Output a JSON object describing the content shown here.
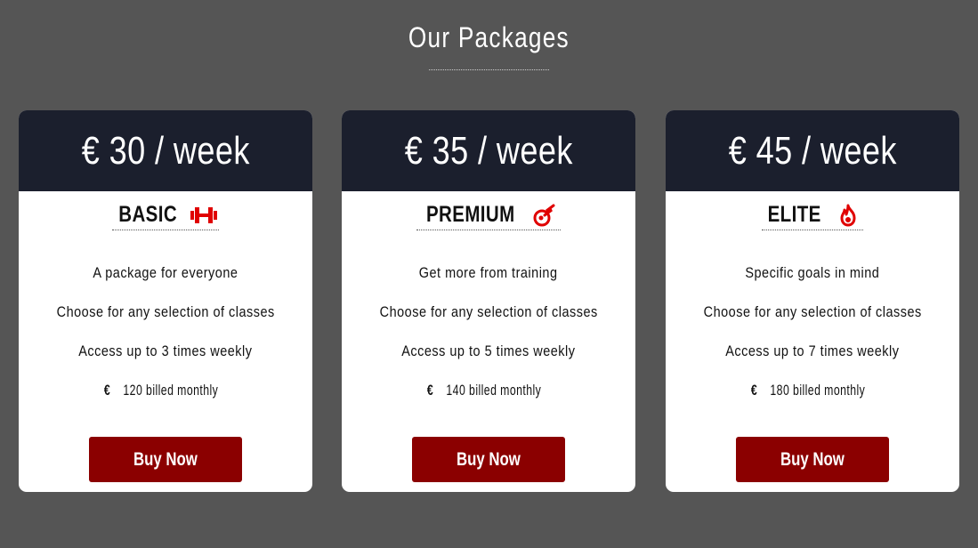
{
  "header": {
    "title": "Our Packages"
  },
  "packages": [
    {
      "price": "€ 30 / week",
      "name": "BASIC",
      "icon": "dumbbell-icon",
      "features": [
        "A package for everyone",
        "Choose for any selection of classes",
        "Access up to 3 times weekly"
      ],
      "billing": "120 billed monthly",
      "currency": "€",
      "button_label": "Buy Now"
    },
    {
      "price": "€ 35 / week",
      "name": "PREMIUM",
      "icon": "meteor-icon",
      "features": [
        "Get more from training",
        "Choose for any selection of classes",
        "Access up to 5 times weekly"
      ],
      "billing": "140 billed monthly",
      "currency": "€",
      "button_label": "Buy Now"
    },
    {
      "price": "€ 45 / week",
      "name": "ELITE",
      "icon": "fire-icon",
      "features": [
        "Specific goals in mind",
        "Choose for any selection of classes",
        "Access up to 7 times weekly"
      ],
      "billing": "180 billed monthly",
      "currency": "€",
      "button_label": "Buy Now"
    }
  ],
  "colors": {
    "background": "#555555",
    "card_header": "#1b1f2d",
    "button": "#8b0000",
    "icon_accent": "#e00000"
  }
}
